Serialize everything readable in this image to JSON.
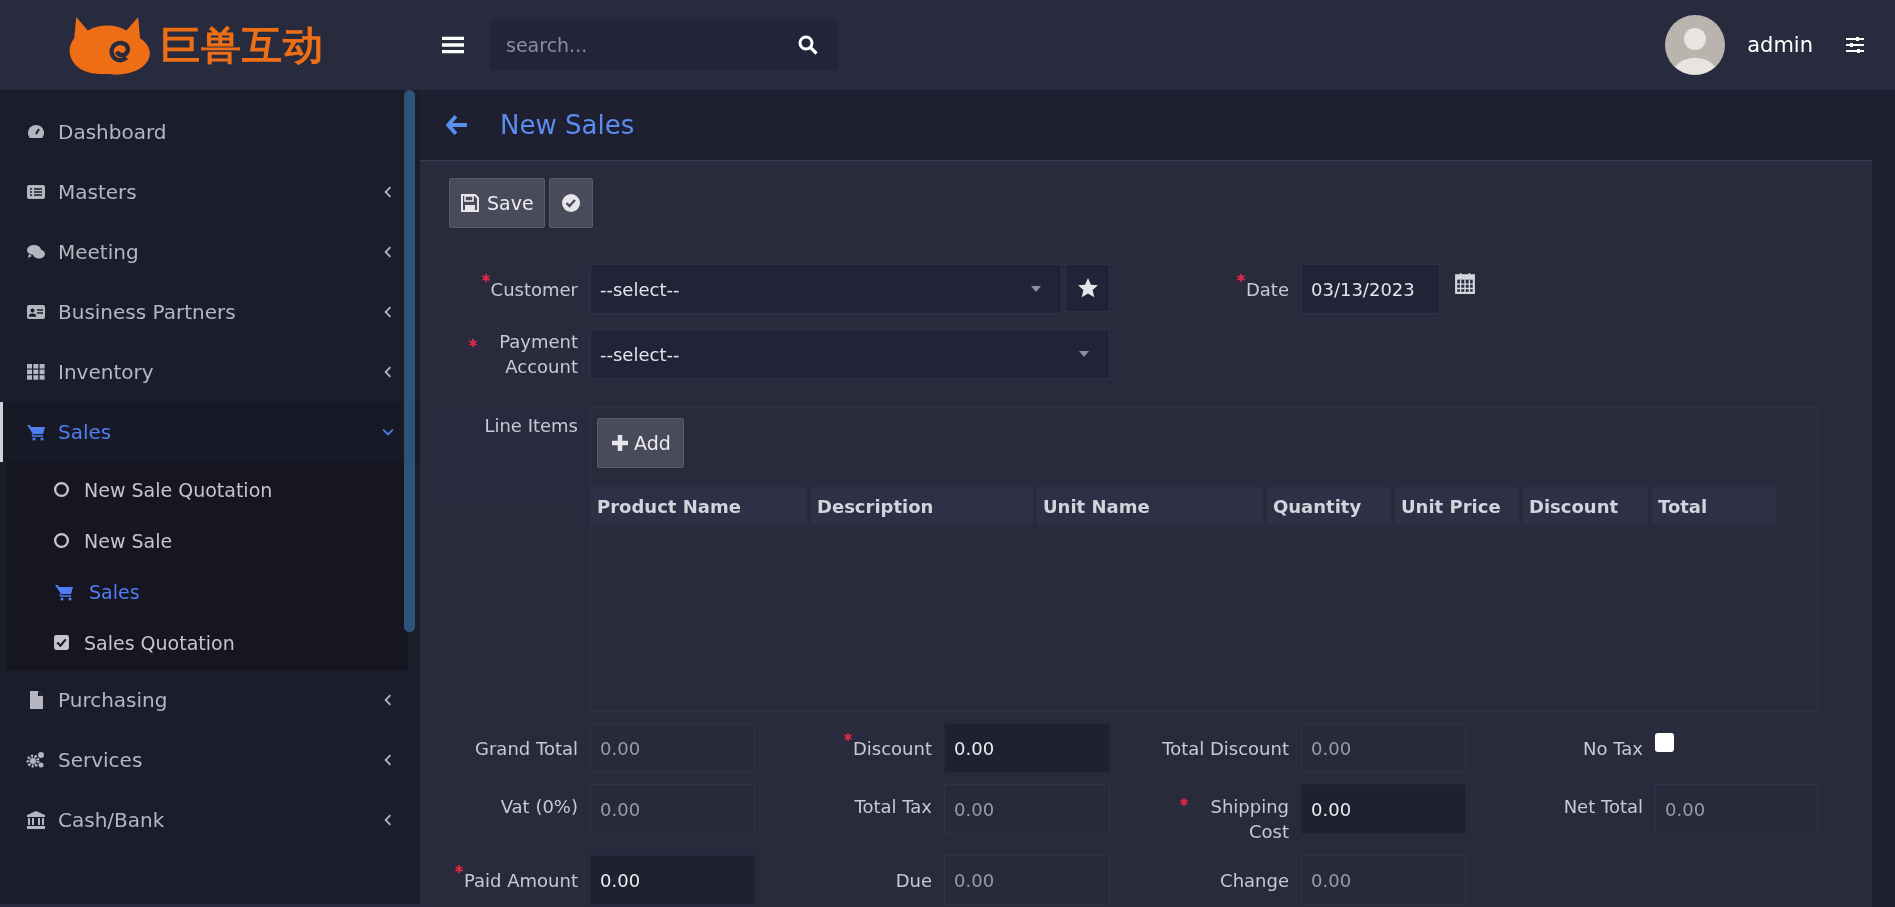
{
  "header": {
    "logo_text": "巨兽互动",
    "search": {
      "placeholder": "search..."
    },
    "user": {
      "name": "admin"
    }
  },
  "sidebar": {
    "items": [
      {
        "label": "Dashboard",
        "kind": "link",
        "selected": false
      },
      {
        "label": "Masters",
        "kind": "menu",
        "selected": false,
        "expanded": false
      },
      {
        "label": "Meeting",
        "kind": "menu",
        "selected": false,
        "expanded": false
      },
      {
        "label": "Business Partners",
        "kind": "menu",
        "selected": false,
        "expanded": false
      },
      {
        "label": "Inventory",
        "kind": "menu",
        "selected": false,
        "expanded": false
      },
      {
        "label": "Sales",
        "kind": "menu",
        "selected": true,
        "expanded": true,
        "children": [
          {
            "label": "New Sale Quotation",
            "selected": false
          },
          {
            "label": "New Sale",
            "selected": false
          },
          {
            "label": "Sales",
            "selected": true
          },
          {
            "label": "Sales Quotation",
            "selected": false
          }
        ]
      },
      {
        "label": "Purchasing",
        "kind": "menu",
        "selected": false,
        "expanded": false
      },
      {
        "label": "Services",
        "kind": "menu",
        "selected": false,
        "expanded": false
      },
      {
        "label": "Cash/Bank",
        "kind": "menu",
        "selected": false,
        "expanded": false
      }
    ]
  },
  "page": {
    "title": "New Sales"
  },
  "toolbar": {
    "save_button": "Save"
  },
  "form": {
    "customer": {
      "label": "Customer",
      "required": true,
      "value": "--select--"
    },
    "date": {
      "label": "Date",
      "required": true,
      "value": "03/13/2023"
    },
    "payment_account": {
      "label": "Payment Account",
      "required": true,
      "value": "--select--"
    },
    "line_items": {
      "label": "Line Items",
      "add_button": "Add",
      "columns": [
        "Product Name",
        "Description",
        "Unit Name",
        "Quantity",
        "Unit Price",
        "Discount",
        "Total"
      ]
    }
  },
  "totals": [
    [
      {
        "kind": "input",
        "label": "Grand Total",
        "value": "0.00",
        "editable": false
      },
      {
        "kind": "input",
        "label": "Discount",
        "value": "0.00",
        "required": true,
        "editable": true
      },
      {
        "kind": "input",
        "label": "Total Discount",
        "value": "0.00",
        "editable": false
      },
      {
        "kind": "checkbox",
        "label": "No Tax",
        "checked": false
      }
    ],
    [
      {
        "kind": "input",
        "label": "Vat (0%)",
        "value": "0.00",
        "editable": false
      },
      {
        "kind": "input",
        "label": "Total Tax",
        "value": "0.00",
        "editable": false
      },
      {
        "kind": "input",
        "label": "Shipping Cost",
        "value": "0.00",
        "required": true,
        "editable": true
      },
      {
        "kind": "input",
        "label": "Net Total",
        "value": "0.00",
        "editable": false
      }
    ],
    [
      {
        "kind": "input",
        "label": "Paid Amount",
        "value": "0.00",
        "required": true,
        "editable": true
      },
      {
        "kind": "input",
        "label": "Due",
        "value": "0.00",
        "editable": false
      },
      {
        "kind": "input",
        "label": "Change",
        "value": "0.00",
        "editable": false
      }
    ]
  ]
}
